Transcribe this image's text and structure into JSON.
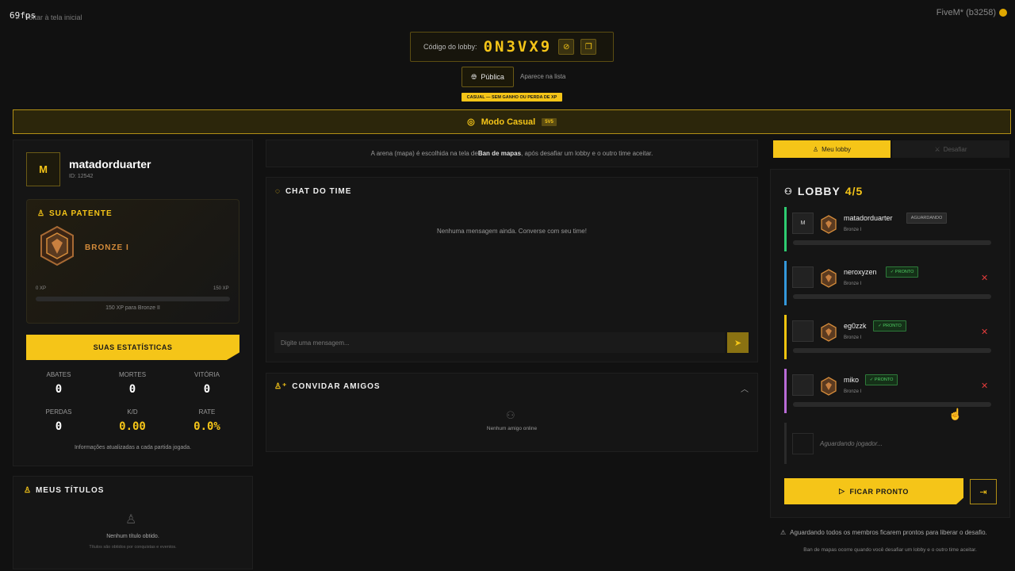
{
  "overlay": {
    "fps": "69fps",
    "back_label": "Voltar à tela inicial",
    "client": "FiveM* (b3258)"
  },
  "lobby_code": {
    "label": "Código do lobby:",
    "value": "0N3VX9"
  },
  "visibility": {
    "label": "Pública",
    "hint": "Aparece na lista",
    "mode_badge": "CASUAL — SEM GANHO OU PERDA DE XP"
  },
  "mode": {
    "label": "Modo Casual",
    "tag": "5V5"
  },
  "player": {
    "initial": "M",
    "name": "matadorduarter",
    "id": "ID: 12542",
    "rank_title": "SUA PATENTE",
    "rank": "BRONZE I",
    "xp_min": "0 XP",
    "xp_max": "150 XP",
    "xp_progress": 0,
    "xp_next": "150 XP para Bronze II",
    "stats_button": "SUAS ESTATÍSTICAS",
    "stats": [
      {
        "label": "ABATES",
        "value": "0"
      },
      {
        "label": "MORTES",
        "value": "0"
      },
      {
        "label": "VITÓRIA",
        "value": "0"
      },
      {
        "label": "PERDAS",
        "value": "0"
      },
      {
        "label": "K/D",
        "value": "0.00"
      },
      {
        "label": "RATE",
        "value": "0.0%"
      }
    ],
    "stats_note": "Informações atualizadas a cada partida jogada."
  },
  "titles": {
    "heading": "MEUS TÍTULOS",
    "empty": "Nenhum título obtido.",
    "sub": "Títulos são obtidos por conquistas e eventos."
  },
  "arena": {
    "pre": "A arena (mapa) é escolhida na tela de ",
    "bold": "Ban de mapas",
    "post": ", após desafiar um lobby e o outro time aceitar."
  },
  "chat": {
    "heading": "CHAT DO TIME",
    "empty": "Nenhuma mensagem ainda. Converse com seu time!",
    "placeholder": "Digite uma mensagem..."
  },
  "invite": {
    "heading": "CONVIDAR AMIGOS",
    "empty": "Nenhum amigo online"
  },
  "tabs": {
    "my_lobby": "Meu lobby",
    "challenge": "Desafiar"
  },
  "lobby": {
    "title": "LOBBY",
    "count": "4/5",
    "members": [
      {
        "name": "matadorduarter",
        "rank": "Bronze I",
        "status": "AGUARDANDO",
        "ready": false,
        "color": "#2ecc71",
        "avatar": "M"
      },
      {
        "name": "neroxyzen",
        "rank": "Bronze I",
        "status": "✓ PRONTO",
        "ready": true,
        "color": "#3498db",
        "avatar": ""
      },
      {
        "name": "eg0zzk",
        "rank": "Bronze I",
        "status": "✓ PRONTO",
        "ready": true,
        "color": "#f1c40f",
        "avatar": ""
      },
      {
        "name": "miko",
        "rank": "Bronze I",
        "status": "✓ PRONTO",
        "ready": true,
        "color": "#b86bd6",
        "avatar": ""
      }
    ],
    "waiting": "Aguardando jogador...",
    "ready_button": "FICAR PRONTO",
    "warning": "Aguardando todos os membros ficarem prontos para liberar o desafio.",
    "note": "Ban de mapas ocorre quando você desafiar um lobby e o outro time aceitar."
  }
}
